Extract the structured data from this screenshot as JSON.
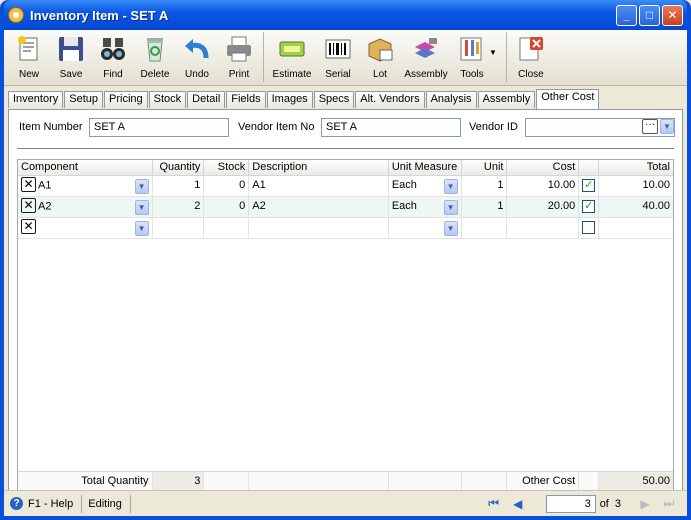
{
  "window": {
    "title": "Inventory Item - SET A"
  },
  "toolbar": {
    "buttons": [
      {
        "label": "New",
        "icon": "new-document-icon"
      },
      {
        "label": "Save",
        "icon": "floppy-disk-icon"
      },
      {
        "label": "Find",
        "icon": "binoculars-icon"
      },
      {
        "label": "Delete",
        "icon": "recycle-bin-icon"
      },
      {
        "label": "Undo",
        "icon": "undo-arrow-icon"
      },
      {
        "label": "Print",
        "icon": "printer-icon"
      },
      {
        "label": "Estimate",
        "icon": "estimate-icon"
      },
      {
        "label": "Serial",
        "icon": "barcode-icon"
      },
      {
        "label": "Lot",
        "icon": "lot-box-icon"
      },
      {
        "label": "Assembly",
        "icon": "assembly-icon"
      },
      {
        "label": "Tools",
        "icon": "tools-icon"
      },
      {
        "label": "Close",
        "icon": "close-form-icon"
      }
    ]
  },
  "tabs": [
    "Inventory",
    "Setup",
    "Pricing",
    "Stock",
    "Detail",
    "Fields",
    "Images",
    "Specs",
    "Alt. Vendors",
    "Analysis",
    "Assembly",
    "Other Cost"
  ],
  "active_tab": "Other Cost",
  "form": {
    "item_number_label": "Item Number",
    "item_number_value": "SET A",
    "vendor_item_no_label": "Vendor Item No",
    "vendor_item_no_value": "SET A",
    "vendor_id_label": "Vendor ID",
    "vendor_id_value": ""
  },
  "grid": {
    "columns": [
      "Component",
      "Quantity",
      "Stock",
      "Description",
      "Unit Measure",
      "Unit",
      "Cost",
      "",
      "Total"
    ],
    "rows": [
      {
        "component": "A1",
        "quantity": "1",
        "stock": "0",
        "description": "A1",
        "unit_measure": "Each",
        "unit": "1",
        "cost": "10.00",
        "checked": true,
        "total": "10.00"
      },
      {
        "component": "A2",
        "quantity": "2",
        "stock": "0",
        "description": "A2",
        "unit_measure": "Each",
        "unit": "1",
        "cost": "20.00",
        "checked": true,
        "total": "40.00"
      },
      {
        "component": "",
        "quantity": "",
        "stock": "",
        "description": "",
        "unit_measure": "",
        "unit": "",
        "cost": "",
        "checked": false,
        "total": ""
      }
    ],
    "footer": {
      "total_quantity_label": "Total Quantity",
      "total_quantity_value": "3",
      "other_cost_label": "Other Cost",
      "other_cost_value": "50.00"
    }
  },
  "status": {
    "help": "F1 - Help",
    "mode": "Editing",
    "page": "3",
    "of_label": "of",
    "page_count": "3"
  }
}
